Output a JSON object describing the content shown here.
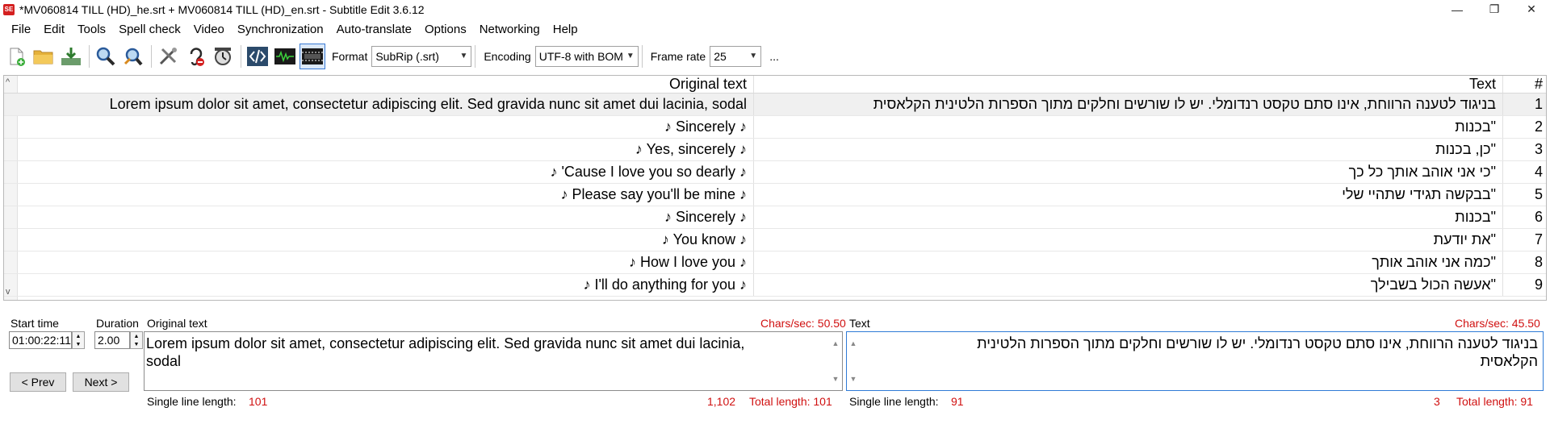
{
  "window": {
    "title": "*MV060814 TILL (HD)_he.srt + MV060814 TILL (HD)_en.srt - Subtitle Edit 3.6.12",
    "app_icon_text": "SE",
    "minimize": "—",
    "restore": "❐",
    "close": "✕"
  },
  "menu": {
    "file": "File",
    "edit": "Edit",
    "tools": "Tools",
    "spell_check": "Spell check",
    "video": "Video",
    "synchronization": "Synchronization",
    "auto_translate": "Auto-translate",
    "options": "Options",
    "networking": "Networking",
    "help": "Help"
  },
  "toolbar": {
    "format_label": "Format",
    "format_value": "SubRip (.srt)",
    "encoding_label": "Encoding",
    "encoding_value": "UTF-8 with BOM",
    "frame_rate_label": "Frame rate",
    "frame_rate_value": "25",
    "more": "..."
  },
  "grid": {
    "headers": {
      "original": "Original text",
      "text": "Text",
      "number": "#"
    },
    "rows": [
      {
        "number": "1",
        "original": "Lorem ipsum dolor sit amet, consectetur adipiscing elit. Sed gravida nunc sit amet dui lacinia, sodal",
        "text": "בניגוד לטענה הרווחת, אינו סתם טקסט רנדומלי. יש לו שורשים וחלקים מתוך הספרות הלטינית הקלאסית"
      },
      {
        "number": "2",
        "original": "♪ Sincerely ♪",
        "text": "\"בכנות"
      },
      {
        "number": "3",
        "original": "♪ Yes, sincerely ♪",
        "text": "\"כן, בכנות"
      },
      {
        "number": "4",
        "original": "♪ 'Cause I love you so dearly ♪",
        "text": "\"כי אני אוהב אותך כל כך"
      },
      {
        "number": "5",
        "original": "♪ Please say you'll be mine ♪",
        "text": "\"בבקשה תגידי שתהיי שלי"
      },
      {
        "number": "6",
        "original": "♪ Sincerely ♪",
        "text": "\"בכנות"
      },
      {
        "number": "7",
        "original": "♪ You know ♪",
        "text": "\"את יודעת"
      },
      {
        "number": "8",
        "original": "♪ How I love you ♪",
        "text": "\"כמה אני אוהב אותך"
      },
      {
        "number": "9",
        "original": "♪ I'll do anything for you ♪",
        "text": "\"אעשה הכול בשבילך"
      }
    ]
  },
  "editor": {
    "start_time_label": "Start time",
    "start_time_value": "01:00:22:11",
    "duration_label": "Duration",
    "duration_value": "2.00",
    "prev_button": "< Prev",
    "next_button": "Next >",
    "original_label": "Original text",
    "original_chars_sec": "Chars/sec: 50.50",
    "original_text_line1": "Lorem ipsum dolor sit amet, consectetur adipiscing elit. Sed gravida nunc sit amet dui lacinia,",
    "original_text_line2": "sodal",
    "original_single_line_label": "Single line length:",
    "original_single_line_value": "101",
    "original_line_lengths": "1,102",
    "original_total_length": "Total length: 101",
    "text_label": "Text",
    "text_chars_sec": "Chars/sec: 45.50",
    "text_line1": "בניגוד לטענה הרווחת, אינו סתם טקסט רנדומלי. יש לו שורשים וחלקים מתוך הספרות הלטינית",
    "text_line2": "הקלאסית",
    "text_single_line_label": "Single line length:",
    "text_single_line_value": "91",
    "text_line_count": "3",
    "text_total_length": "Total length: 91"
  }
}
